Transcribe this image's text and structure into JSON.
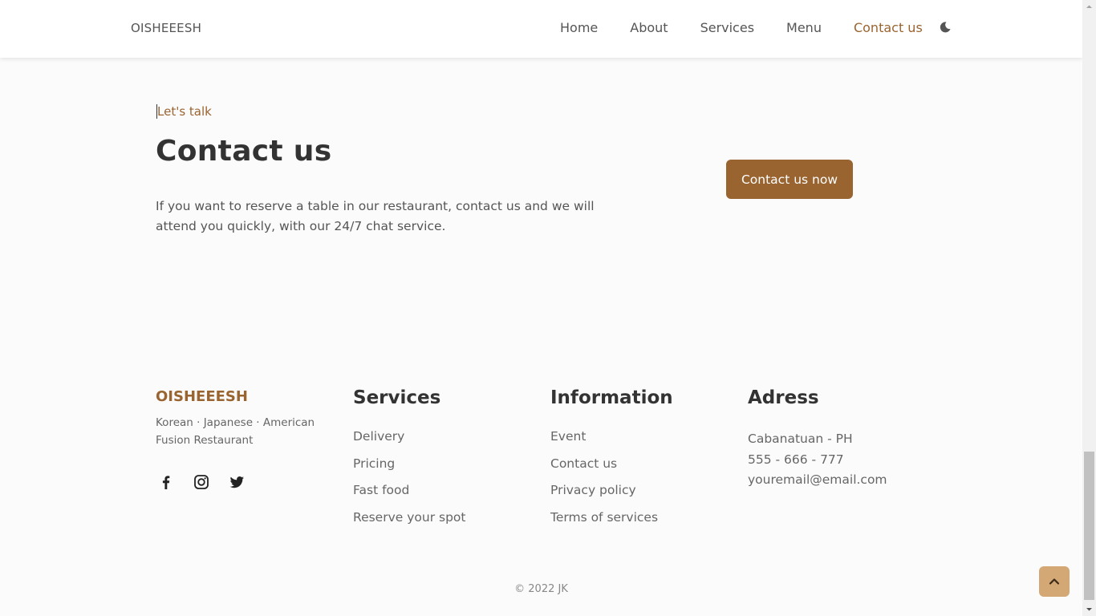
{
  "header": {
    "logo": "OISHEEESH",
    "nav": [
      "Home",
      "About",
      "Services",
      "Menu",
      "Contact us"
    ],
    "active_nav": "Contact us",
    "theme_icon": "moon-icon"
  },
  "contact": {
    "eyebrow": "Let's talk",
    "title": "Contact us",
    "description": "If you want to reserve a table in our restaurant, contact us and we will attend you quickly, with our 24/7 chat service.",
    "button_label": "Contact us now"
  },
  "footer": {
    "brand": {
      "name": "OISHEEESH",
      "description": "Korean · Japanese · American Fusion Restaurant",
      "social_icons": [
        "facebook-icon",
        "instagram-icon",
        "twitter-icon"
      ]
    },
    "services": {
      "title": "Services",
      "links": [
        "Delivery",
        "Pricing",
        "Fast food",
        "Reserve your spot"
      ]
    },
    "information": {
      "title": "Information",
      "links": [
        "Event",
        "Contact us",
        "Privacy policy",
        "Terms of services"
      ]
    },
    "address": {
      "title": "Adress",
      "lines": [
        "Cabanatuan - PH",
        "555 - 666 - 777",
        "youremail@email.com"
      ]
    },
    "copyright": "© 2022 JK"
  },
  "colors": {
    "accent": "#9a6430",
    "scroll_button": "#d4a875",
    "text_dark": "#333333",
    "text_muted": "#666666"
  }
}
